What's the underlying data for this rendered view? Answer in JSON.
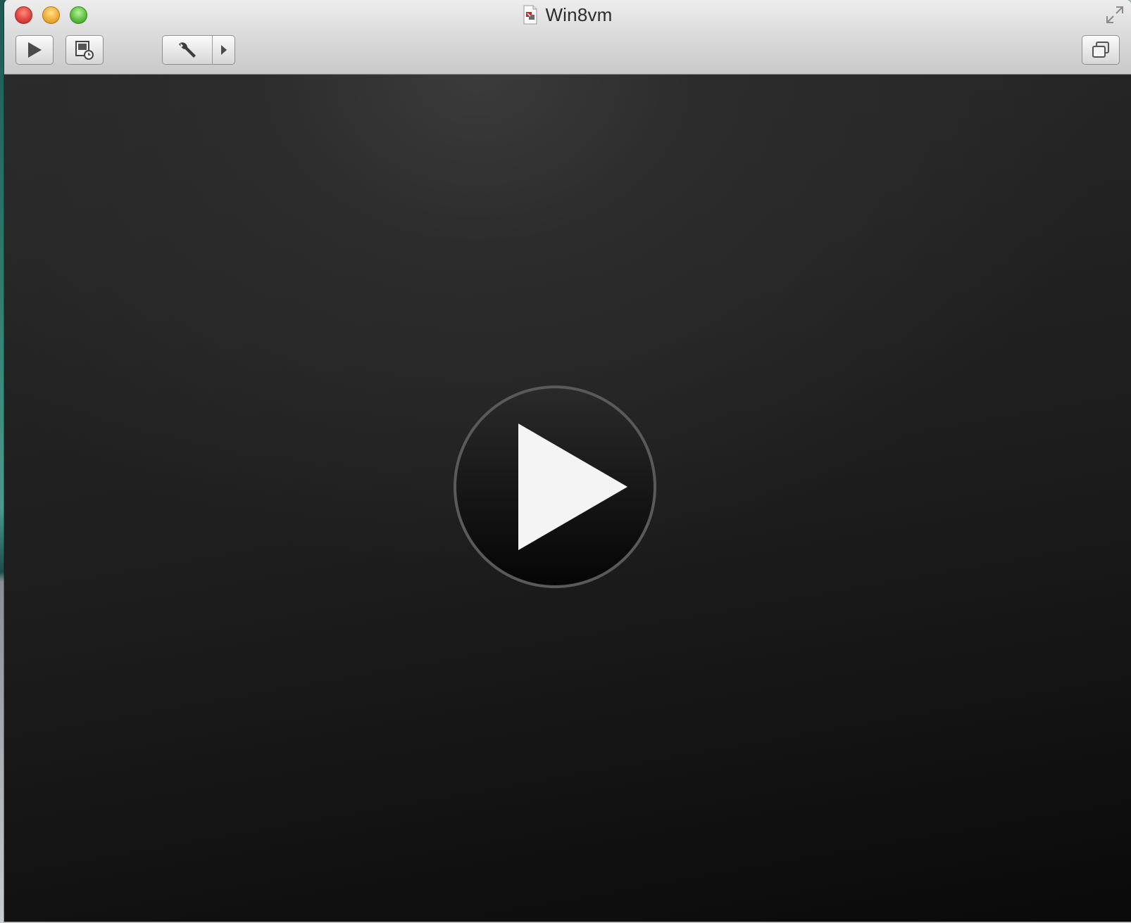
{
  "window": {
    "title": "Win8vm"
  },
  "toolbar": {
    "items": [
      {
        "name": "start-vm",
        "icon": "play-icon"
      },
      {
        "name": "snapshots",
        "icon": "snapshot-icon"
      },
      {
        "name": "settings",
        "icon": "wrench-icon",
        "has_menu": true
      },
      {
        "name": "window-mode",
        "icon": "window-stack-icon"
      }
    ]
  },
  "content": {
    "center_icon": "play-circle-icon"
  },
  "colors": {
    "close": "#e0443e",
    "minimize": "#f2ae3a",
    "zoom": "#5fc23f",
    "content_bg": "#1c1c1c",
    "play_glyph": "#f4f4f4"
  }
}
